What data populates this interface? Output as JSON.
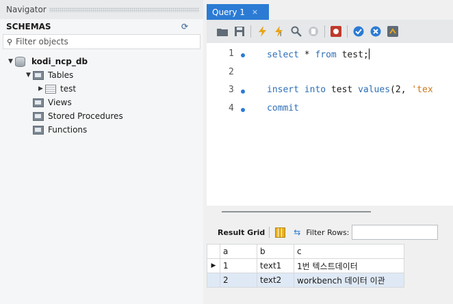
{
  "navigator": {
    "title": "Navigator",
    "schemas_label": "SCHEMAS",
    "filter_placeholder": "Filter objects",
    "tree": {
      "db": "kodi_ncp_db",
      "tables": "Tables",
      "table_item": "test",
      "views": "Views",
      "stored_procedures": "Stored Procedures",
      "functions": "Functions"
    }
  },
  "tab": {
    "label": "Query 1",
    "close": "×"
  },
  "editor": {
    "lines": [
      {
        "num": "1",
        "kw1": "select",
        "mid": " * ",
        "kw2": "from",
        "rest": " test;"
      },
      {
        "num": "2"
      },
      {
        "num": "3",
        "kw1": "insert",
        "mid": " ",
        "kw2": "into",
        "rest": " test ",
        "kw3": "values",
        "tail": "(2, ",
        "str": "'tex"
      },
      {
        "num": "4",
        "kw1": "commit"
      }
    ]
  },
  "result": {
    "grid_label": "Result Grid",
    "filter_label": "Filter Rows:",
    "columns": [
      "a",
      "b",
      "c"
    ],
    "rows": [
      [
        "1",
        "text1",
        "1번 텍스트데이터"
      ],
      [
        "2",
        "text2",
        "workbench 데이터 이관"
      ]
    ]
  },
  "colors": {
    "accent": "#2b7bd4",
    "keyword": "#2d6fb7",
    "string": "#c9781b"
  }
}
